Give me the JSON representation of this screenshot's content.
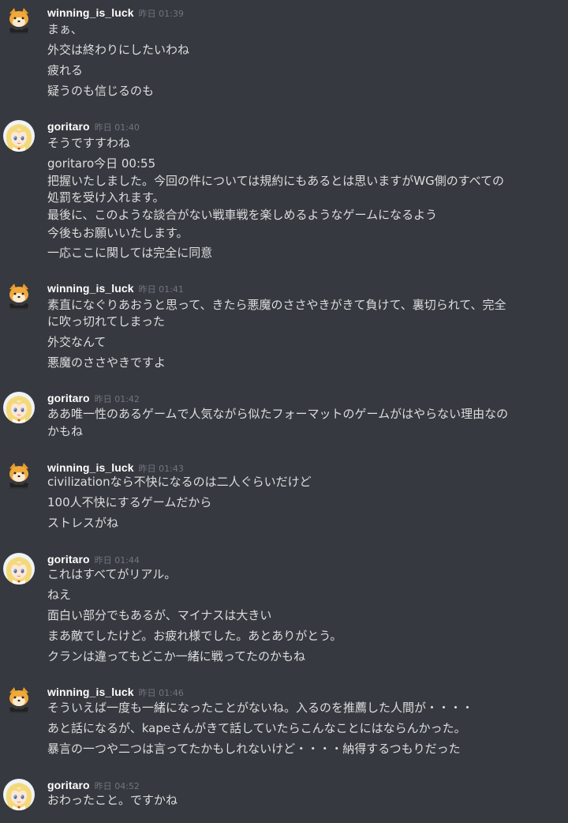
{
  "messages": [
    {
      "username": "winning_is_luck",
      "timestamp": "昨日 01:39",
      "avatar": "shiba-inu-avatar",
      "lines": [
        "まぁ、",
        "外交は終わりにしたいわね",
        "疲れる",
        "疑うのも信じるのも"
      ]
    },
    {
      "username": "goritaro",
      "timestamp": "昨日 01:40",
      "avatar": "blonde-anime-girl-avatar",
      "lines": [
        "そうですすわね",
        "goritaro今日 00:55",
        "把握いたしました。今回の件については規約にもあるとは思いますがWG側のすべての",
        "処罰を受け入れます。",
        "最後に、このような談合がない戦車戦を楽しめるようなゲームになるよう",
        "今後もお願いいたします。",
        "一応ここに関しては完全に同意"
      ]
    },
    {
      "username": "winning_is_luck",
      "timestamp": "昨日 01:41",
      "avatar": "shiba-inu-avatar",
      "lines": [
        "素直になぐりあおうと思って、きたら悪魔のささやきがきて負けて、裏切られて、完全",
        "に吹っ切れてしまった",
        "外交なんて",
        "悪魔のささやきですよ"
      ]
    },
    {
      "username": "goritaro",
      "timestamp": "昨日 01:42",
      "avatar": "blonde-anime-girl-avatar",
      "lines": [
        "ああ唯一性のあるゲームで人気ながら似たフォーマットのゲームがはやらない理由なの",
        "かもね"
      ]
    },
    {
      "username": "winning_is_luck",
      "timestamp": "昨日 01:43",
      "avatar": "shiba-inu-avatar",
      "lines": [
        "civilizationなら不快になるのは二人ぐらいだけど",
        "100人不快にするゲームだから",
        "ストレスがね"
      ]
    },
    {
      "username": "goritaro",
      "timestamp": "昨日 01:44",
      "avatar": "blonde-anime-girl-avatar",
      "lines": [
        "これはすべてがリアル。",
        "ねえ",
        "面白い部分でもあるが、マイナスは大きい",
        "まあ敵でしたけど。お疲れ様でした。あとありがとう。",
        "クランは違ってもどこか一緒に戦ってたのかもね"
      ]
    },
    {
      "username": "winning_is_luck",
      "timestamp": "昨日 01:46",
      "avatar": "shiba-inu-avatar",
      "lines": [
        "そういえば一度も一緒になったことがないね。入るのを推薦した人間が・・・・",
        "あと話になるが、kapeさんがきて話していたらこんなことにはならんかった。",
        "暴言の一つや二つは言ってたかもしれないけど・・・・納得するつもりだった"
      ]
    },
    {
      "username": "goritaro",
      "timestamp": "昨日 04:52",
      "avatar": "blonde-anime-girl-avatar",
      "lines": [
        "おわったこと。ですかね"
      ]
    }
  ]
}
